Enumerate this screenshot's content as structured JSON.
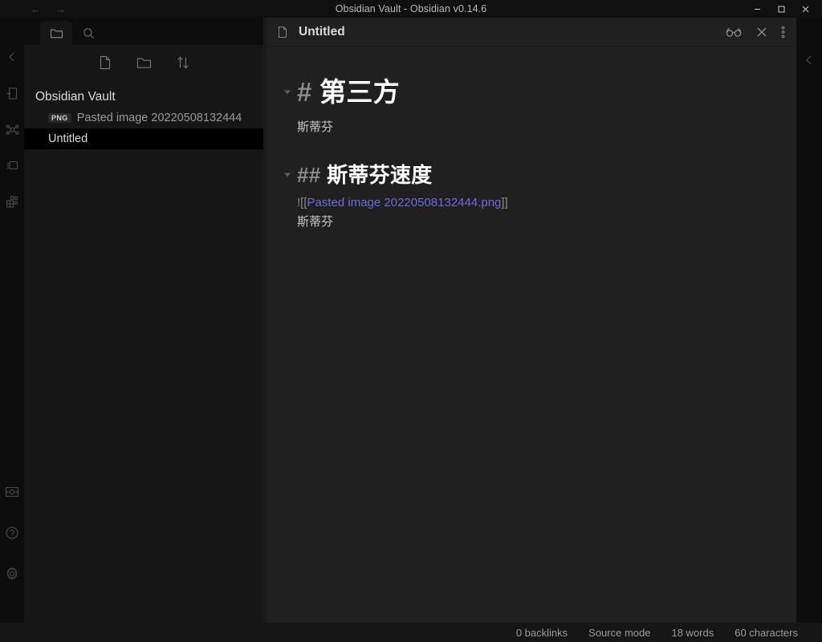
{
  "window": {
    "title": "Obsidian Vault - Obsidian v0.14.6",
    "nav_back": "←",
    "nav_forward": "→",
    "minimize_label": "Minimize",
    "maximize_label": "Maximize",
    "close_label": "Close"
  },
  "ribbon": {
    "collapse_label": "Collapse",
    "items": [
      {
        "name": "open-note-icon",
        "label": "Open note"
      },
      {
        "name": "graph-view-icon",
        "label": "Open graph view"
      },
      {
        "name": "canvas-icon",
        "label": "Open canvas"
      },
      {
        "name": "plugins-grid-icon",
        "label": "Plugins"
      }
    ],
    "bottom_items": [
      {
        "name": "vault-switcher-icon",
        "label": "Open another vault"
      },
      {
        "name": "help-icon",
        "label": "Help"
      },
      {
        "name": "settings-icon",
        "label": "Settings"
      }
    ]
  },
  "sidebar": {
    "tabs": [
      {
        "name": "tab-file-explorer",
        "label": "Files",
        "active": true
      },
      {
        "name": "tab-search",
        "label": "Search",
        "active": false
      }
    ],
    "toolbar": [
      {
        "name": "new-note-button",
        "label": "New note"
      },
      {
        "name": "new-folder-button",
        "label": "New folder"
      },
      {
        "name": "sort-button",
        "label": "Change sort order"
      }
    ],
    "vault_name": "Obsidian Vault",
    "files": [
      {
        "badge": "PNG",
        "label": "Pasted image 20220508132444",
        "selected": false
      },
      {
        "badge": "",
        "label": "Untitled",
        "selected": true
      }
    ]
  },
  "note": {
    "icon_label": "Note",
    "title": "Untitled",
    "actions": [
      {
        "name": "reading-view-icon",
        "label": "Current view: editing"
      },
      {
        "name": "close-icon",
        "label": "Close"
      },
      {
        "name": "more-options-icon",
        "label": "More options"
      }
    ],
    "content": {
      "h1_mark": "#",
      "h1_text": "第三方",
      "para1": "斯蒂芬",
      "h2_mark": "##",
      "h2_text": "斯蒂芬速度",
      "embed_prefix": "![[",
      "embed_link": "Pasted image 20220508132444.png",
      "embed_suffix": "]]",
      "para2": "斯蒂芬"
    }
  },
  "right_sidebar": {
    "expand_label": "Expand right sidebar"
  },
  "statusbar": {
    "backlinks": "0 backlinks",
    "mode": "Source mode",
    "words": "18 words",
    "characters": "60 characters"
  },
  "colors": {
    "link": "#6c6cdc",
    "background": "#202020",
    "sidebar": "#161616",
    "ribbon": "#0d0d0d",
    "selected_row": "#000000"
  }
}
